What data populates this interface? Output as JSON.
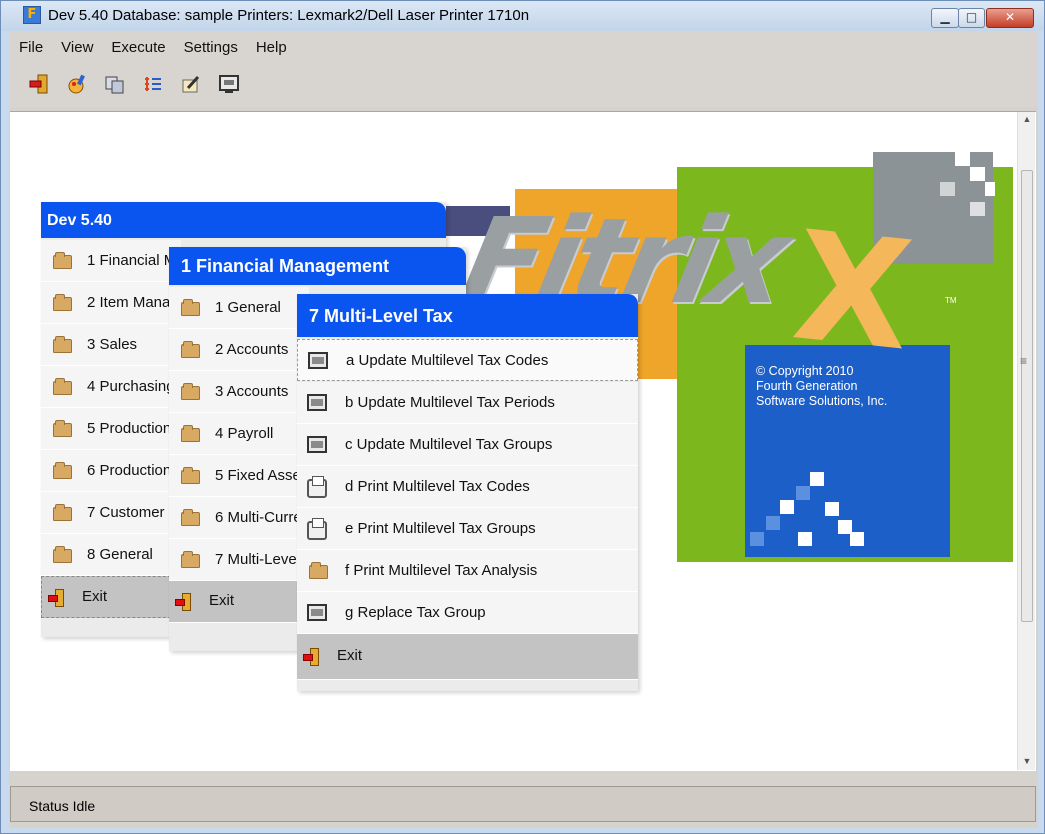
{
  "window": {
    "title": "Dev 5.40 Database: sample Printers: Lexmark2/Dell Laser Printer 1710n",
    "min_glyph": "▁",
    "max_glyph": "□",
    "close_glyph": "✕"
  },
  "menubar": [
    "File",
    "View",
    "Execute",
    "Settings",
    "Help"
  ],
  "toolbar": [
    "exit-icon",
    "paint-icon",
    "copy-windows-icon",
    "list-icon",
    "edit-icon",
    "terminal-icon"
  ],
  "logo": {
    "text": "Fitrix",
    "trademark": "TM",
    "copyright_lines": [
      "© Copyright 2010",
      "Fourth Generation",
      "Software Solutions, Inc."
    ],
    "colors": {
      "orange": "#efa42a",
      "green": "#7cb81d",
      "gray": "#8c9396",
      "blue": "#1c5fc9"
    }
  },
  "menu1": {
    "title": "Dev 5.40",
    "items": [
      "1 Financial Management",
      "2 Item Management",
      "3 Sales",
      "4 Purchasing",
      "5 Production",
      "6 Production",
      "7 Customer",
      "8 General"
    ],
    "exit": "Exit"
  },
  "menu2": {
    "title": "1 Financial Management",
    "items": [
      "1 General",
      "2 Accounts",
      "3 Accounts",
      "4 Payroll",
      "5 Fixed Assets",
      "6 Multi-Currency",
      "7 Multi-Level Tax"
    ],
    "exit": "Exit"
  },
  "menu3": {
    "title": "7 Multi-Level Tax",
    "items": [
      {
        "label": "a  Update Multilevel Tax Codes",
        "icon": "screen-icon"
      },
      {
        "label": "b  Update Multilevel Tax Periods",
        "icon": "screen-icon"
      },
      {
        "label": "c  Update Multilevel Tax Groups",
        "icon": "screen-icon"
      },
      {
        "label": "d  Print Multilevel Tax Codes",
        "icon": "printer-icon"
      },
      {
        "label": "e  Print Multilevel Tax Groups",
        "icon": "printer-icon"
      },
      {
        "label": "f  Print Multilevel Tax Analysis",
        "icon": "folder-icon"
      },
      {
        "label": "g  Replace Tax Group",
        "icon": "screen-icon"
      }
    ],
    "exit": "Exit"
  },
  "status": "Status  Idle"
}
